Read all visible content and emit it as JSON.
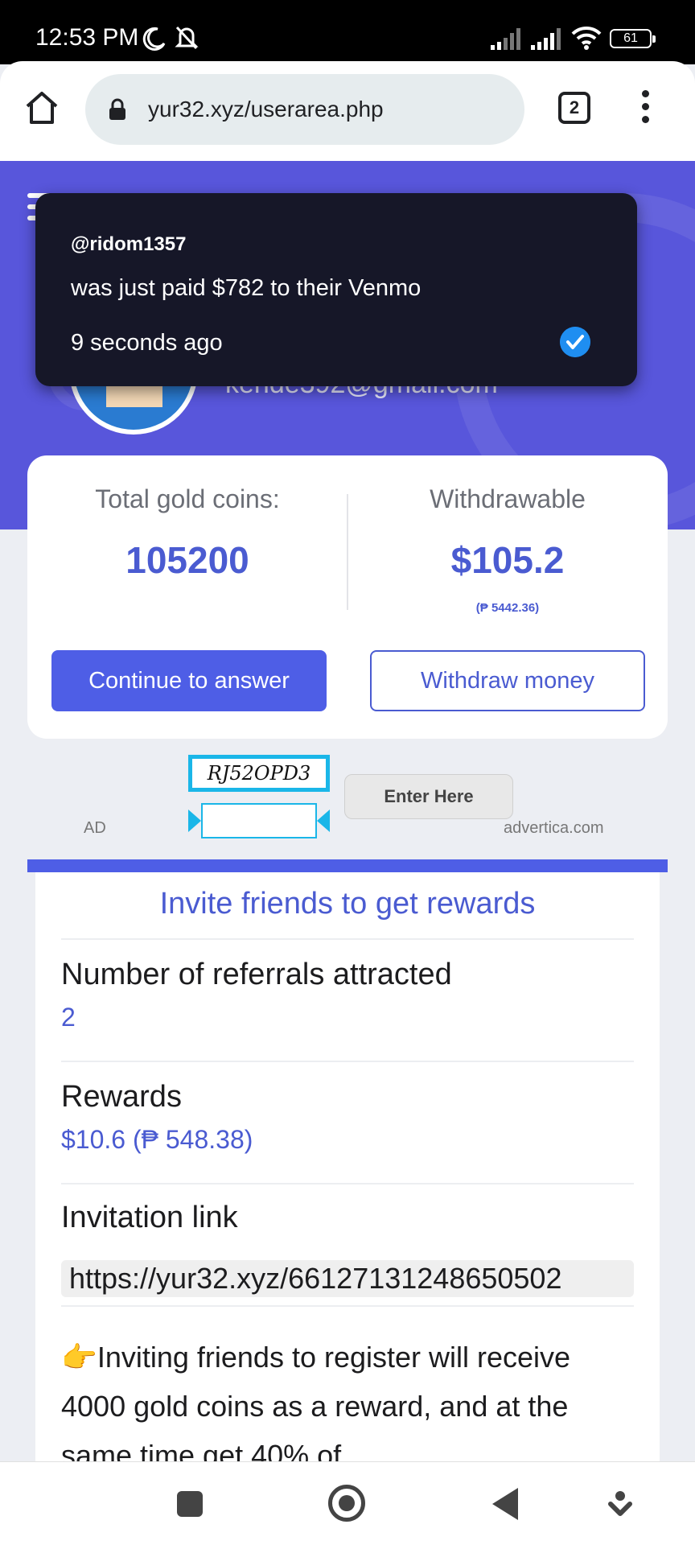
{
  "status_bar": {
    "time": "12:53 PM",
    "battery": "61",
    "icons": [
      "moon-icon",
      "bell-off-icon",
      "signal-icon",
      "signal-icon",
      "wifi-icon",
      "battery-icon"
    ]
  },
  "browser": {
    "url": "yur32.xyz/userarea.php",
    "tab_count": "2"
  },
  "profile": {
    "email": "kende392@gmail.com"
  },
  "stats": {
    "total_label": "Total gold coins:",
    "total_value": "105200",
    "withdrawable_label": "Withdrawable",
    "withdrawable_value": "$105.2",
    "withdrawable_sub": "(₱ 5442.36)",
    "continue_label": "Continue to answer",
    "withdraw_label": "Withdraw money"
  },
  "ad": {
    "label": "AD",
    "captcha": "RJ52OPD3",
    "enter_label": "Enter Here",
    "domain": "advertica.com"
  },
  "invite": {
    "title": "Invite friends to get rewards",
    "referrals_label": "Number of referrals attracted",
    "referrals_value": "2",
    "rewards_label": "Rewards",
    "rewards_value": "$10.6 (₱ 548.38)",
    "link_label": "Invitation link",
    "link_value": "https://yur32.xyz/66127131248650502",
    "text": "👉Inviting friends to register will receive 4000 gold coins as a reward, and at the same time get 40% of"
  },
  "toast": {
    "user": "@ridom1357",
    "message": "was just paid $782 to their Venmo",
    "time": "9 seconds ago"
  },
  "colors": {
    "brand": "#5856db",
    "accent": "#4a5bd1",
    "button": "#4e5ee6",
    "toast_bg": "#161728",
    "check": "#1f8ef1"
  }
}
